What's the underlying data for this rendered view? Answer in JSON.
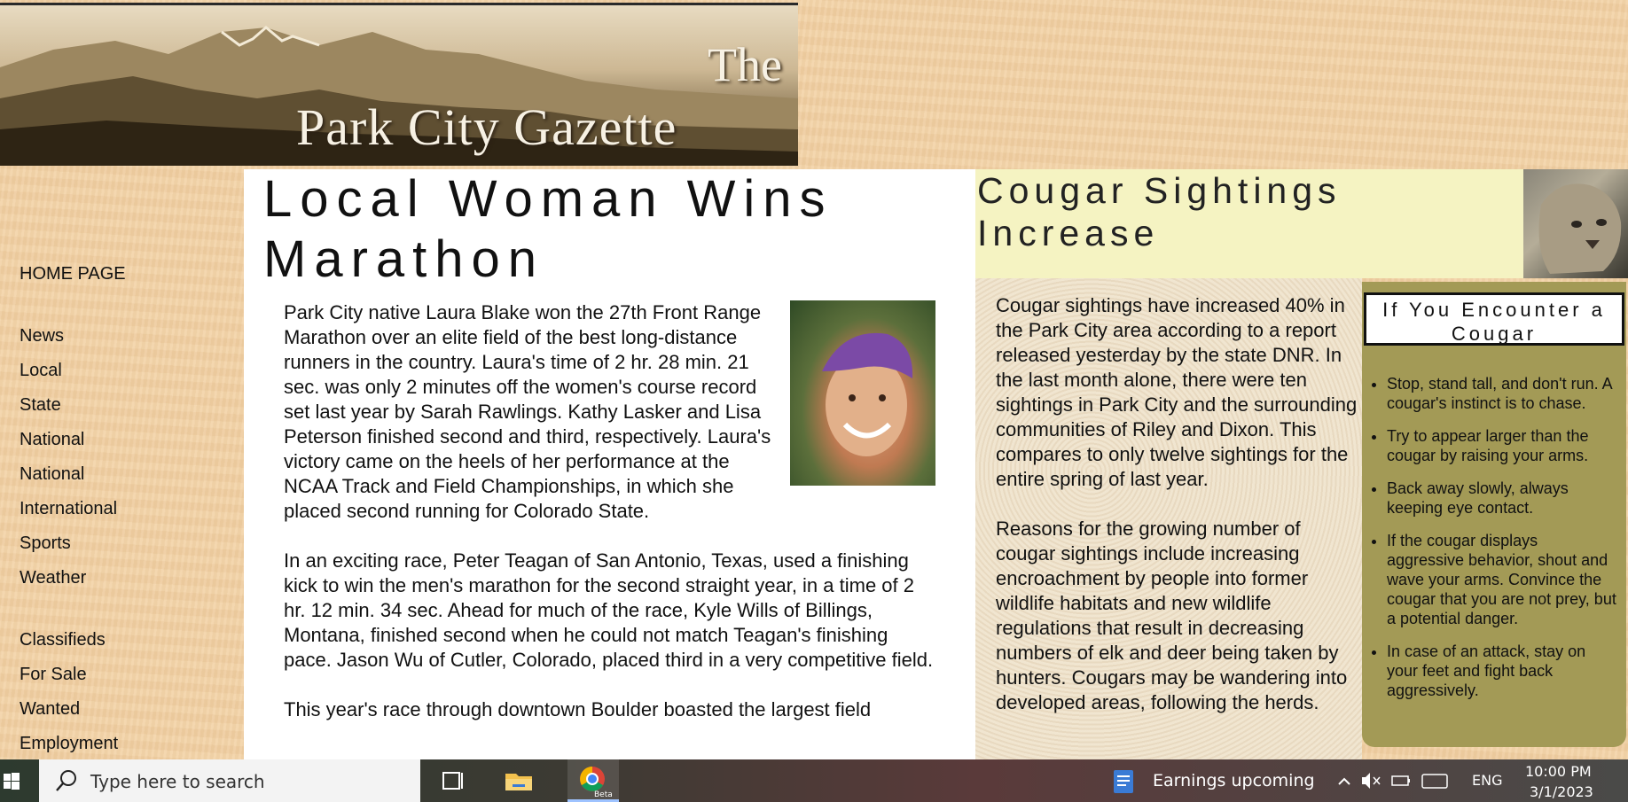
{
  "masthead": {
    "the": "The",
    "title": "Park City Gazette"
  },
  "nav": {
    "items": [
      {
        "label": "HOME PAGE"
      },
      {
        "label": "News"
      },
      {
        "label": "Local"
      },
      {
        "label": "State"
      },
      {
        "label": "National"
      },
      {
        "label": "National"
      },
      {
        "label": "International"
      },
      {
        "label": "Sports"
      },
      {
        "label": "Weather"
      },
      {
        "label": "Classifieds"
      },
      {
        "label": "For Sale"
      },
      {
        "label": "Wanted"
      },
      {
        "label": "Employment"
      }
    ]
  },
  "main_article": {
    "title": "Local Woman Wins Marathon",
    "paragraphs": [
      "Park City native Laura Blake won the 27th Front Range Marathon over an elite field of the best long-distance runners in the country. Laura's time of 2 hr. 28 min. 21 sec. was only 2 minutes off the women's course record set last year by Sarah Rawlings. Kathy Lasker and Lisa Peterson finished second and third, respectively. Laura's victory came on the heels of her performance at the NCAA Track and Field Championships, in which she placed second running for Colorado State.",
      "In an exciting race, Peter Teagan of San Antonio, Texas, used a finishing kick to win the men's marathon for the second straight year, in a time of 2 hr. 12 min. 34 sec. Ahead for much of the race, Kyle Wills of Billings, Montana, finished second when he could not match Teagan's finishing pace. Jason Wu of Cutler, Colorado, placed third in a very competitive field.",
      "This year's race through downtown Boulder boasted the largest field"
    ]
  },
  "side_article": {
    "title": "Cougar Sightings Increase",
    "paragraphs": [
      "Cougar sightings have increased 40% in the Park City area according to a report released yesterday by the state DNR. In the last month alone, there were ten sightings in Park City and the surrounding communities of Riley and Dixon. This compares to only twelve sightings for the entire spring of last year.",
      "Reasons for the growing number of cougar sightings include increasing encroachment by people into former wildlife habitats and new wildlife regulations that result in decreasing numbers of elk and deer being taken by hunters. Cougars may be wandering into developed areas, following the herds."
    ]
  },
  "sidebar": {
    "title": "If You Encounter a Cougar",
    "tips": [
      "Stop, stand tall, and don't run. A cougar's instinct is to chase.",
      "Try to appear larger than the cougar by raising your arms.",
      "Back away slowly, always keeping eye contact.",
      "If the cougar displays aggressive behavior, shout and wave your arms. Convince the cougar that you are not prey, but a potential danger.",
      "In case of an attack, stay on your feet and fight back aggressively."
    ]
  },
  "taskbar": {
    "search_placeholder": "Type here to search",
    "news_widget": "Earnings upcoming",
    "language": "ENG",
    "time": "10:00 PM",
    "date": "3/1/2023",
    "chrome_badge": "Beta"
  },
  "colors": {
    "page_bg": "#f2d3a8",
    "side_header_bg": "#f5f3c2",
    "sidebar_bg": "#a39a56"
  }
}
